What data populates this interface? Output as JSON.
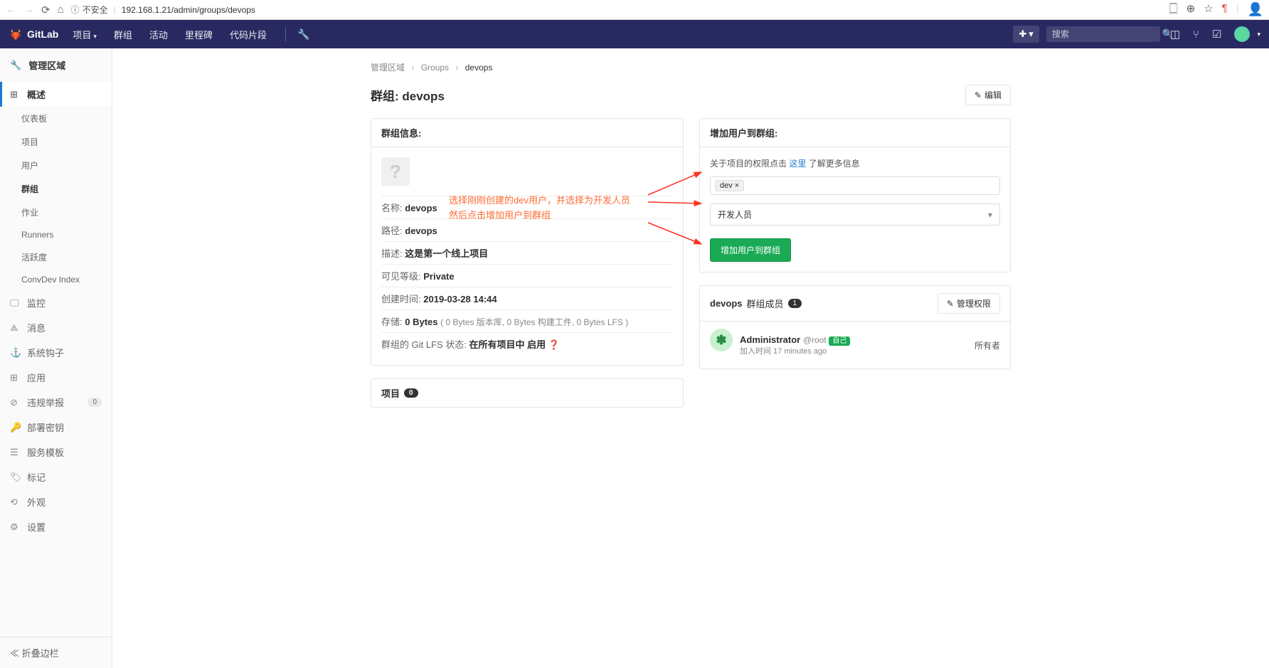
{
  "browser": {
    "insecure_label": "不安全",
    "url": "192.168.1.21/admin/groups/devops"
  },
  "topnav": {
    "brand": "GitLab",
    "items": [
      {
        "label": "项目",
        "has_chevron": true
      },
      {
        "label": "群组"
      },
      {
        "label": "活动"
      },
      {
        "label": "里程碑"
      },
      {
        "label": "代码片段"
      }
    ],
    "search_placeholder": "搜索"
  },
  "sidebar": {
    "header": "管理区域",
    "items": [
      {
        "icon": "⊞",
        "label": "概述",
        "active": true,
        "sub": false
      },
      {
        "label": "仪表板",
        "sub": true
      },
      {
        "label": "项目",
        "sub": true
      },
      {
        "label": "用户",
        "sub": true
      },
      {
        "label": "群组",
        "sub": true,
        "current": true
      },
      {
        "label": "作业",
        "sub": true
      },
      {
        "label": "Runners",
        "sub": true
      },
      {
        "label": "活跃度",
        "sub": true
      },
      {
        "label": "ConvDev Index",
        "sub": true
      },
      {
        "icon": "🖵",
        "label": "监控",
        "sub": false
      },
      {
        "icon": "⟁",
        "label": "消息",
        "sub": false
      },
      {
        "icon": "⚓",
        "label": "系统钩子",
        "sub": false
      },
      {
        "icon": "⊞",
        "label": "应用",
        "sub": false
      },
      {
        "icon": "⊘",
        "label": "违规举报",
        "sub": false,
        "badge": "0"
      },
      {
        "icon": "🔑",
        "label": "部署密钥",
        "sub": false
      },
      {
        "icon": "☰",
        "label": "服务模板",
        "sub": false
      },
      {
        "icon": "🏷",
        "label": "标记",
        "sub": false
      },
      {
        "icon": "⟲",
        "label": "外观",
        "sub": false
      },
      {
        "icon": "⚙",
        "label": "设置",
        "sub": false
      }
    ],
    "collapse": "折叠边栏"
  },
  "breadcrumb": {
    "admin": "管理区域",
    "groups": "Groups",
    "current": "devops"
  },
  "page_title": "群组: devops",
  "edit_btn": "编辑",
  "group_info": {
    "header": "群组信息:",
    "name_lbl": "名称:",
    "name_val": "devops",
    "path_lbl": "路径:",
    "path_val": "devops",
    "desc_lbl": "描述:",
    "desc_val": "这是第一个线上项目",
    "vis_lbl": "可见等级:",
    "vis_val": "Private",
    "created_lbl": "创建时间:",
    "created_val": "2019-03-28 14:44",
    "storage_lbl": "存储:",
    "storage_val": "0 Bytes",
    "storage_detail": "( 0 Bytes 版本库, 0 Bytes 构建工件, 0 Bytes LFS )",
    "lfs_lbl": "群组的 Git LFS 状态:",
    "lfs_val": "在所有项目中 启用"
  },
  "projects": {
    "header": "项目",
    "count": "0"
  },
  "add_user": {
    "header": "增加用户到群组:",
    "hint_pre": "关于项目的权限点击",
    "hint_link": "这里",
    "hint_post": "了解更多信息",
    "chip": "dev ×",
    "role_select": "开发人员",
    "submit": "增加用户到群组"
  },
  "members": {
    "group": "devops",
    "suffix": "群组成员",
    "count": "1",
    "manage_btn": "管理权限",
    "list": [
      {
        "name": "Administrator",
        "username": "@root",
        "self": "自己",
        "joined_pre": "加入时间",
        "joined_val": "17 minutes ago",
        "role": "所有者"
      }
    ]
  },
  "annotation": {
    "line1": "选择刚刚创建的dev用户，并选择为开发人员",
    "line2": "然后点击增加用户到群组"
  }
}
